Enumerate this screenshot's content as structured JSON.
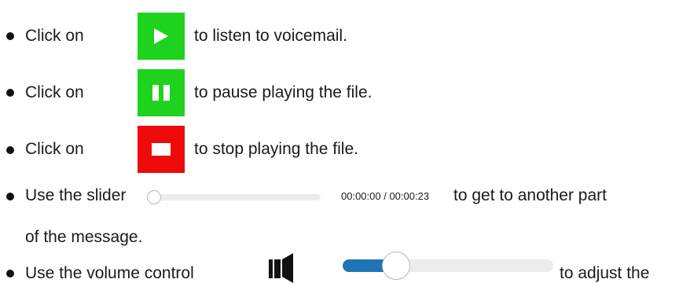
{
  "items": [
    {
      "prefix": "Click on",
      "suffix": "to listen to voicemail.",
      "button_icon": "play-icon"
    },
    {
      "prefix": "Click on",
      "suffix": "to pause playing the file.",
      "button_icon": "pause-icon"
    },
    {
      "prefix": "Click on",
      "suffix": "to stop playing the file.",
      "button_icon": "stop-icon"
    },
    {
      "prefix": "Use the slider",
      "time_readout": "00:00:00 / 00:00:23",
      "suffix": "to get to another part",
      "continuation": "of the message."
    },
    {
      "prefix": "Use the volume control",
      "suffix": "to adjust the"
    }
  ],
  "playback_slider": {
    "position_fraction": 0.0
  },
  "volume": {
    "level_fraction": 0.2,
    "icon": "speaker-icon"
  },
  "colors": {
    "play": "#1ed31e",
    "pause": "#1ed31e",
    "stop": "#ee0a0a",
    "volume_fill": "#1e74b4"
  }
}
